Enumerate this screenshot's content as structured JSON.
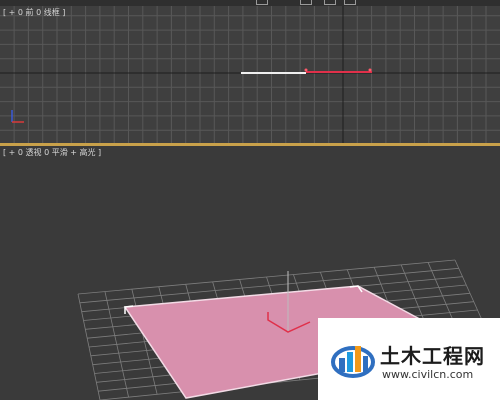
{
  "top_viewport": {
    "label": "[ + 0 前 0 线框 ]"
  },
  "bottom_viewport": {
    "label": "[ + 0 透视 0 平滑 + 高光 ]"
  },
  "watermark": {
    "title": "土木工程网",
    "url": "www.civilcn.com"
  },
  "colors": {
    "viewport_bg": "#3f3f3f",
    "grid_line": "#5a5a5a",
    "grid_line_light": "#8a8a8a",
    "plane_fill": "#d890ad",
    "selection_red": "#e0304a",
    "separator": "#c9a14a"
  },
  "icons": {
    "axis_gizmo": "axis-gizmo-icon",
    "watermark_logo": "civilcn-logo-icon"
  }
}
